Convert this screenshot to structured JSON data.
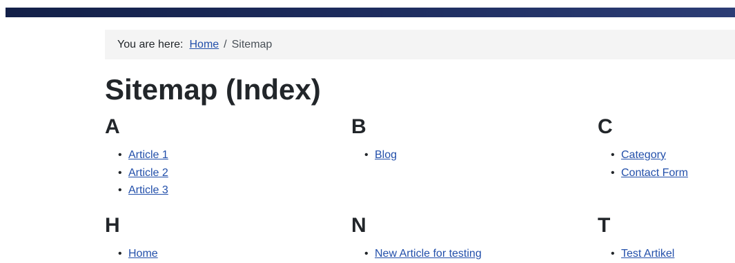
{
  "breadcrumb": {
    "prefix": "You are here:",
    "home": "Home",
    "separator": "/",
    "current": "Sitemap"
  },
  "page_title": "Sitemap (Index)",
  "groups": [
    {
      "letter": "A",
      "items": [
        "Article 1",
        "Article 2",
        "Article 3"
      ]
    },
    {
      "letter": "B",
      "items": [
        "Blog"
      ]
    },
    {
      "letter": "C",
      "items": [
        "Category",
        "Contact Form"
      ]
    },
    {
      "letter": "H",
      "items": [
        "Home"
      ]
    },
    {
      "letter": "N",
      "items": [
        "New Article for testing"
      ]
    },
    {
      "letter": "T",
      "items": [
        "Test Artikel"
      ]
    }
  ],
  "colors": {
    "header_bar": "#1d2c5e",
    "link": "#224faa",
    "breadcrumb_bg": "#f4f4f4"
  }
}
